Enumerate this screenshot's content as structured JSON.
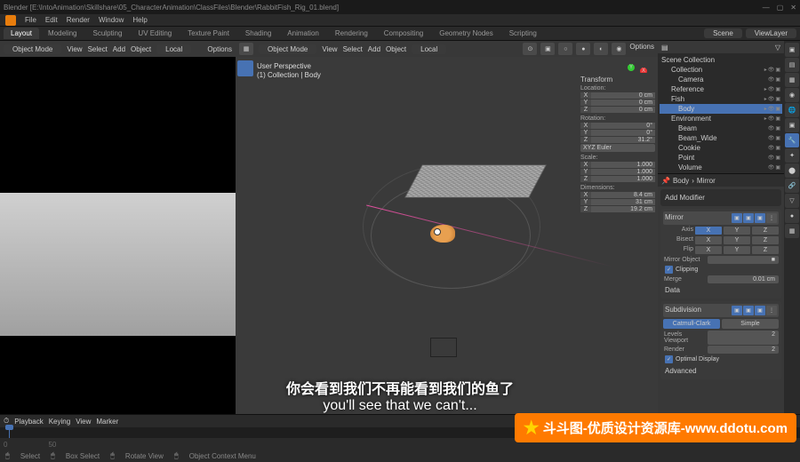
{
  "title": "Blender [E:\\IntoAnimation\\Skillshare\\05_CharacterAnimation\\ClassFiles\\Blender\\RabbitFish_Rig_01.blend]",
  "menu": {
    "file": "File",
    "edit": "Edit",
    "render": "Render",
    "window": "Window",
    "help": "Help"
  },
  "tabs": {
    "layout": "Layout",
    "modeling": "Modeling",
    "sculpting": "Sculpting",
    "uv": "UV Editing",
    "texture": "Texture Paint",
    "shading": "Shading",
    "animation": "Animation",
    "rendering": "Rendering",
    "compositing": "Compositing",
    "geo": "Geometry Nodes",
    "scripting": "Scripting"
  },
  "tabright": {
    "scene": "Scene",
    "viewlayer": "ViewLayer"
  },
  "left_hdr": {
    "mode": "Object Mode",
    "view": "View",
    "select": "Select",
    "add": "Add",
    "object": "Object",
    "local": "Local",
    "options": "Options"
  },
  "vp_hdr": {
    "mode": "Object Mode",
    "view": "View",
    "select": "Select",
    "add": "Add",
    "object": "Object",
    "local": "Local",
    "options": "Options"
  },
  "vp_info": {
    "persp": "User Perspective",
    "coll": "(1) Collection | Body"
  },
  "outliner": {
    "root": "Scene Collection",
    "items": [
      {
        "name": "Collection",
        "ind": 8
      },
      {
        "name": "Camera",
        "ind": 16
      },
      {
        "name": "Reference",
        "ind": 8
      },
      {
        "name": "Fish",
        "ind": 8
      },
      {
        "name": "Body",
        "ind": 16,
        "sel": true
      },
      {
        "name": "Environment",
        "ind": 8
      },
      {
        "name": "Beam",
        "ind": 16
      },
      {
        "name": "Beam_Wide",
        "ind": 16
      },
      {
        "name": "Cookie",
        "ind": 16
      },
      {
        "name": "Point",
        "ind": 16
      },
      {
        "name": "Volume",
        "ind": 16
      }
    ]
  },
  "nside": {
    "transform": "Transform",
    "location": "Location:",
    "loc": {
      "x": "0 cm",
      "y": "0 cm",
      "z": "0 cm"
    },
    "rotation": "Rotation:",
    "rot": {
      "x": "0°",
      "y": "0°",
      "z": "31.2°"
    },
    "euler": "XYZ Euler",
    "scale": "Scale:",
    "sca": {
      "x": "1.000",
      "y": "1.000",
      "z": "1.000"
    },
    "dimensions": "Dimensions:",
    "dim": {
      "x": "8.4 cm",
      "y": "31 cm",
      "z": "19.2 cm"
    }
  },
  "props": {
    "breadcrumb_body": "Body",
    "breadcrumb_mirror": "Mirror",
    "add": "Add Modifier",
    "mirror": {
      "name": "Mirror",
      "axis": "Axis",
      "bisect": "Bisect",
      "flip": "Flip",
      "x": "X",
      "y": "Y",
      "z": "Z",
      "mirror_obj": "Mirror Object",
      "clipping": "Clipping",
      "merge": "Merge",
      "merge_val": "0.01 cm",
      "data": "Data"
    },
    "subdiv": {
      "name": "Subdivision",
      "catmull": "Catmull-Clark",
      "simple": "Simple",
      "levels": "Levels Viewport",
      "levels_val": "2",
      "render": "Render",
      "render_val": "2",
      "optimal": "Optimal Display",
      "advanced": "Advanced"
    }
  },
  "timeline": {
    "playback": "Playback",
    "keying": "Keying",
    "view": "View",
    "marker": "Marker",
    "start": "0",
    "end": "50"
  },
  "status": {
    "select": "Select",
    "box": "Box Select",
    "rotate": "Rotate View",
    "ctx": "Object Context Menu"
  },
  "subtitle": {
    "cn": "你会看到我们不再能看到我们的鱼了",
    "en": "you'll see that we can't..."
  },
  "watermark": "斗斗图-优质设计资源库-www.ddotu.com"
}
